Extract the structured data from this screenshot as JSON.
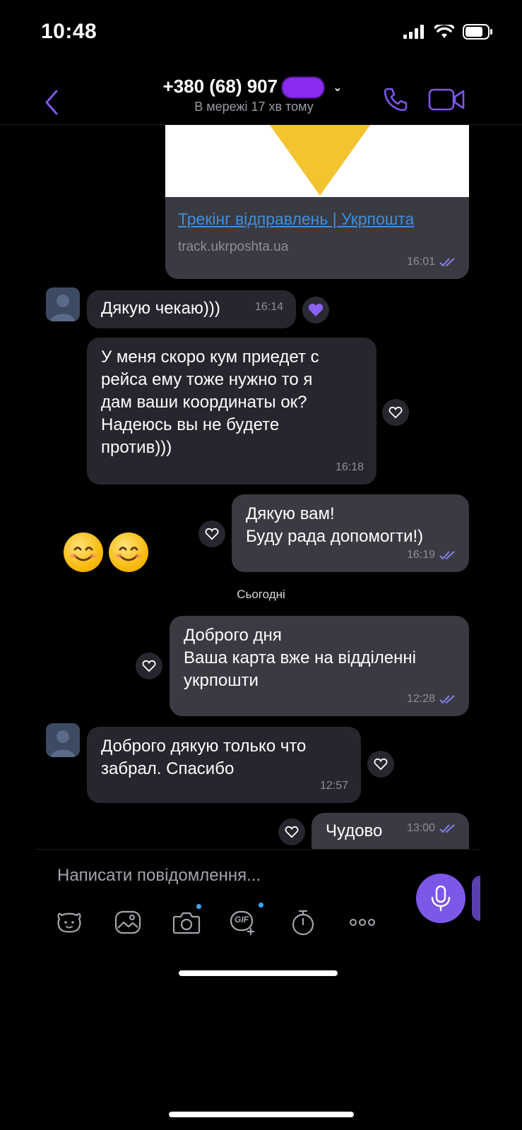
{
  "status_bar": {
    "time": "10:48"
  },
  "header": {
    "contact": "+380 (68) 907",
    "presence": "В мережі 17 хв тому"
  },
  "link_preview": {
    "title": "Трекінг відправлень | Укрпошта",
    "domain": "track.ukrposhta.ua",
    "time": "16:01"
  },
  "messages": [
    {
      "id": "m1",
      "dir": "in",
      "text": "Дякую чекаю)))",
      "time": "16:14"
    },
    {
      "id": "m2",
      "dir": "in",
      "text": "У меня скоро кум приедет с\nрейса ему тоже нужно то я\nдам ваши координаты ок?\nНадеюсь вы не будете\nпротив)))",
      "time": "16:18"
    },
    {
      "id": "m3",
      "dir": "out",
      "text": "Дякую вам!\nБуду рада допомогти!)",
      "time": "16:19"
    },
    {
      "id": "m4",
      "dir": "out",
      "text": "Доброго дня\nВаша карта вже на відділенні\nукрпошти",
      "time": "12:28"
    },
    {
      "id": "m5",
      "dir": "in",
      "text": "Доброго дякую только что\nзабрал. Спасибо",
      "time": "12:57"
    },
    {
      "id": "m6",
      "dir": "out",
      "text": "Чудово",
      "time": "13:00"
    }
  ],
  "day_separator": "Сьогодні",
  "composer": {
    "placeholder": "Написати повідомлення..."
  },
  "toolbar": {
    "gif_label": "GIF",
    "icons": [
      "sticker-icon",
      "gallery-icon",
      "camera-icon",
      "gif-icon",
      "timer-icon",
      "more-icon"
    ]
  },
  "colors": {
    "accent": "#7d57e8",
    "outgoing": "#3a3a42",
    "incoming": "#26262e",
    "link": "#3d8fe0"
  }
}
